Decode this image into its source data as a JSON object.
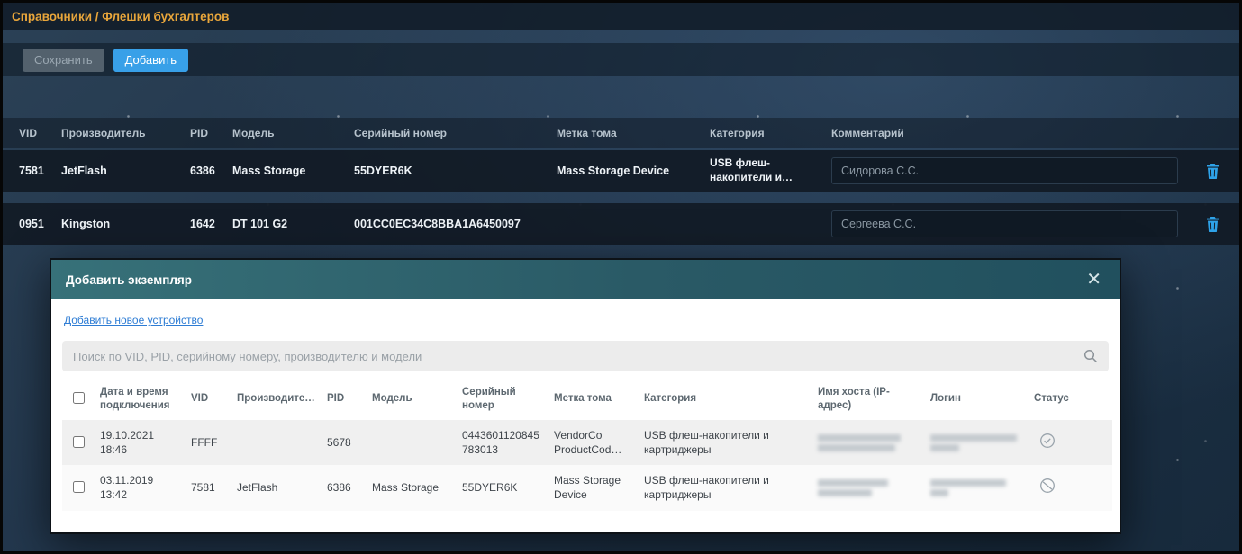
{
  "page": {
    "breadcrumb": "Справочники / Флешки бухгалтеров"
  },
  "toolbar": {
    "save_label": "Сохранить",
    "add_label": "Добавить"
  },
  "main_table": {
    "columns": [
      "VID",
      "Производитель",
      "PID",
      "Модель",
      "Серийный номер",
      "Метка тома",
      "Категория",
      "Комментарий"
    ],
    "rows": [
      {
        "vid": "7581",
        "manufacturer": "JetFlash",
        "pid": "6386",
        "model": "Mass Storage",
        "serial": "55DYER6K",
        "volume_label": "Mass Storage Device",
        "category": "USB флеш-накопители и…",
        "comment": "Сидорова С.С."
      },
      {
        "vid": "0951",
        "manufacturer": "Kingston",
        "pid": "1642",
        "model": "DT 101 G2",
        "serial": "001CC0EC34C8BBA1A6450097",
        "volume_label": "",
        "category": "",
        "comment": "Сергеева С.С."
      }
    ]
  },
  "modal": {
    "title": "Добавить экземпляр",
    "close_icon": "✕",
    "add_device_link": "Добавить новое устройство",
    "search_placeholder": "Поиск по VID, PID, серийному номеру, производителю и модели",
    "columns": [
      "Дата и время подключения",
      "VID",
      "Производите…",
      "PID",
      "Модель",
      "Серийный номер",
      "Метка тома",
      "Категория",
      "Имя хоста (IP-адрес)",
      "Логин",
      "Статус"
    ],
    "rows": [
      {
        "datetime": "19.10.2021 18:46",
        "vid": "FFFF",
        "manufacturer": "",
        "pid": "5678",
        "model": "",
        "serial": "0443601120845783013",
        "volume_label": "VendorCo ProductCod…",
        "category": "USB флеш-накопители и картриджеры",
        "status": "allowed"
      },
      {
        "datetime": "03.11.2019 13:42",
        "vid": "7581",
        "manufacturer": "JetFlash",
        "pid": "6386",
        "model": "Mass Storage",
        "serial": "55DYER6K",
        "volume_label": "Mass Storage Device",
        "category": "USB флеш-накопители и картриджеры",
        "status": "blocked"
      }
    ]
  },
  "colors": {
    "accent": "#38a0e8",
    "breadcrumb_text": "#e9a63b",
    "modal_header": "#2a5a66"
  }
}
